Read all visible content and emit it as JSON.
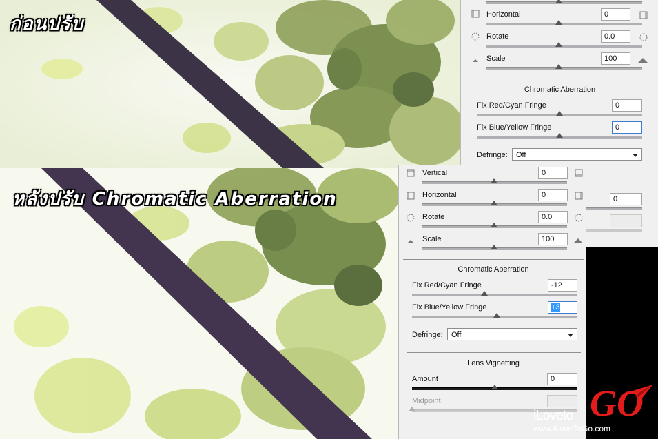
{
  "overlay": {
    "before_label": "ก่อนปรับ",
    "after_label": "หลังปรับ Chromatic Aberration"
  },
  "panel_top": {
    "transform_rows": [
      {
        "label": "Horizontal",
        "value": "0",
        "left_icon": "horizontal-perspective-left-icon",
        "right_icon": "horizontal-perspective-right-icon"
      },
      {
        "label": "Rotate",
        "value": "0.0",
        "left_icon": "rotate-left-icon",
        "right_icon": "rotate-right-icon"
      },
      {
        "label": "Scale",
        "value": "100",
        "left_icon": "scale-down-icon",
        "right_icon": "scale-up-icon"
      }
    ],
    "chromatic_title": "Chromatic Aberration",
    "fix_red_cyan": {
      "label": "Fix Red/Cyan Fringe",
      "value": "0"
    },
    "fix_blue_yellow": {
      "label": "Fix Blue/Yellow Fringe",
      "value": "0"
    },
    "defringe": {
      "label": "Defringe:",
      "selected": "Off"
    },
    "partial_value": "0"
  },
  "panel_bottom": {
    "transform_rows": [
      {
        "label": "Vertical",
        "value": "0",
        "left_icon": "vertical-perspective-top-icon",
        "right_icon": "vertical-perspective-bottom-icon"
      },
      {
        "label": "Horizontal",
        "value": "0",
        "left_icon": "horizontal-perspective-left-icon",
        "right_icon": "horizontal-perspective-right-icon"
      },
      {
        "label": "Rotate",
        "value": "0.0",
        "left_icon": "rotate-left-icon",
        "right_icon": "rotate-right-icon"
      },
      {
        "label": "Scale",
        "value": "100",
        "left_icon": "scale-down-icon",
        "right_icon": "scale-up-icon"
      }
    ],
    "chromatic_title": "Chromatic Aberration",
    "fix_red_cyan": {
      "label": "Fix Red/Cyan Fringe",
      "value": "-12"
    },
    "fix_blue_yellow": {
      "label": "Fix Blue/Yellow Fringe",
      "value": "+3"
    },
    "defringe": {
      "label": "Defringe:",
      "selected": "Off"
    },
    "vignetting_title": "Lens Vignetting",
    "amount": {
      "label": "Amount",
      "value": "0"
    },
    "midpoint": {
      "label": "Midpoint",
      "value": ""
    }
  },
  "logo": {
    "brand": "iLoveto",
    "brand_go": "GO",
    "url": "www.iLoveToGo.com"
  },
  "colors": {
    "logo_red": "#e21b1b",
    "selection_blue": "#3399ff",
    "panel_bg": "#f0f0f0"
  }
}
